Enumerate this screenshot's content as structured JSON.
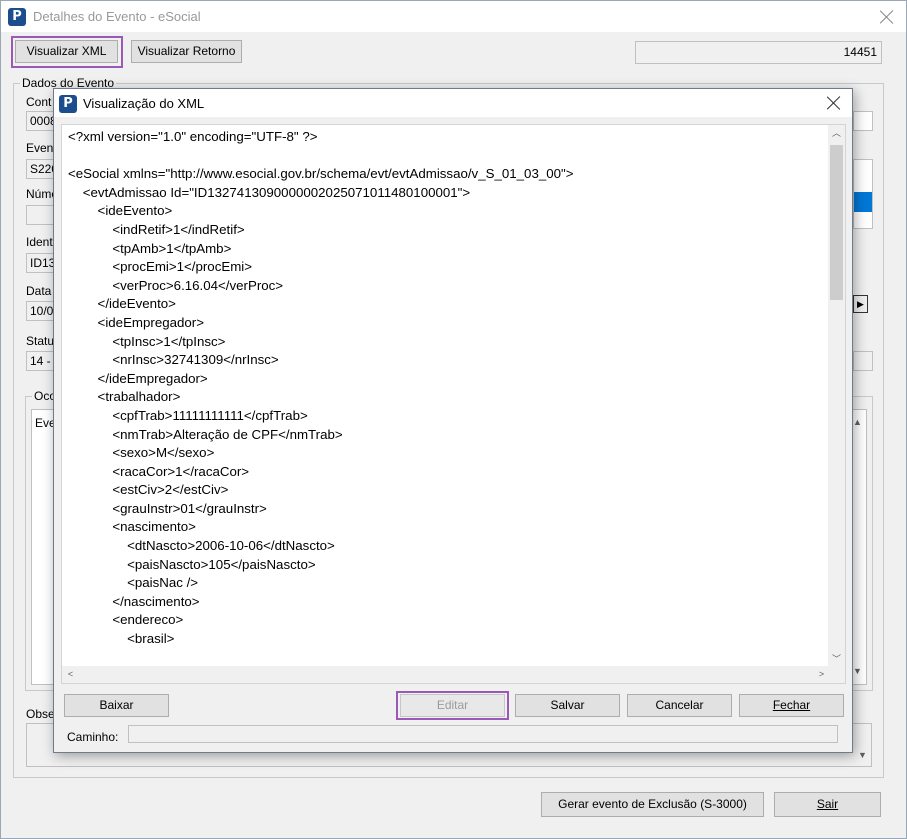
{
  "main_window": {
    "title": "Detalhes do Evento - eSocial",
    "btn_visualizar_xml": "Visualizar XML",
    "btn_visualizar_retorno": "Visualizar Retorno",
    "id_value": "14451",
    "group_dados_evento": "Dados do Evento",
    "fields": [
      {
        "label": "Cont",
        "value": "0008"
      },
      {
        "label": "Even",
        "value": "S220"
      },
      {
        "label": "Núme",
        "value": ""
      },
      {
        "label": "Ident",
        "value": "ID13"
      },
      {
        "label": "Data",
        "value": "10/0"
      },
      {
        "label": "Statu",
        "value": "14 -"
      }
    ],
    "group_ocorrencias": "Oco",
    "ocorrencias_text": "Eve",
    "observacoes_label": "Obse",
    "btn_gerar_exclusao": "Gerar evento de Exclusão (S-3000)",
    "btn_sair": "Sair"
  },
  "xml_dialog": {
    "title": "Visualização do XML",
    "lines": [
      "<?xml version=\"1.0\" encoding=\"UTF-8\" ?>",
      "",
      "<eSocial xmlns=\"http://www.esocial.gov.br/schema/evt/evtAdmissao/v_S_01_03_00\">",
      "    <evtAdmissao Id=\"ID1327413090000002025071011480100001\">",
      "        <ideEvento>",
      "            <indRetif>1</indRetif>",
      "            <tpAmb>1</tpAmb>",
      "            <procEmi>1</procEmi>",
      "            <verProc>6.16.04</verProc>",
      "        </ideEvento>",
      "        <ideEmpregador>",
      "            <tpInsc>1</tpInsc>",
      "            <nrInsc>32741309</nrInsc>",
      "        </ideEmpregador>",
      "        <trabalhador>",
      "            <cpfTrab>11111111111</cpfTrab>",
      "            <nmTrab>Alteração de CPF</nmTrab>",
      "            <sexo>M</sexo>",
      "            <racaCor>1</racaCor>",
      "            <estCiv>2</estCiv>",
      "            <grauInstr>01</grauInstr>",
      "            <nascimento>",
      "                <dtNascto>2006-10-06</dtNascto>",
      "                <paisNascto>105</paisNascto>",
      "                <paisNac />",
      "            </nascimento>",
      "            <endereco>",
      "                <brasil>"
    ],
    "btn_baixar": "Baixar",
    "btn_editar": "Editar",
    "btn_salvar": "Salvar",
    "btn_cancelar": "Cancelar",
    "btn_fechar": "Fechar",
    "caminho_label": "Caminho:",
    "caminho_value": ""
  },
  "colors": {
    "highlight": "#9b59b6",
    "selection_blue": "#0078d7",
    "logo_blue": "#1c4d8c"
  }
}
